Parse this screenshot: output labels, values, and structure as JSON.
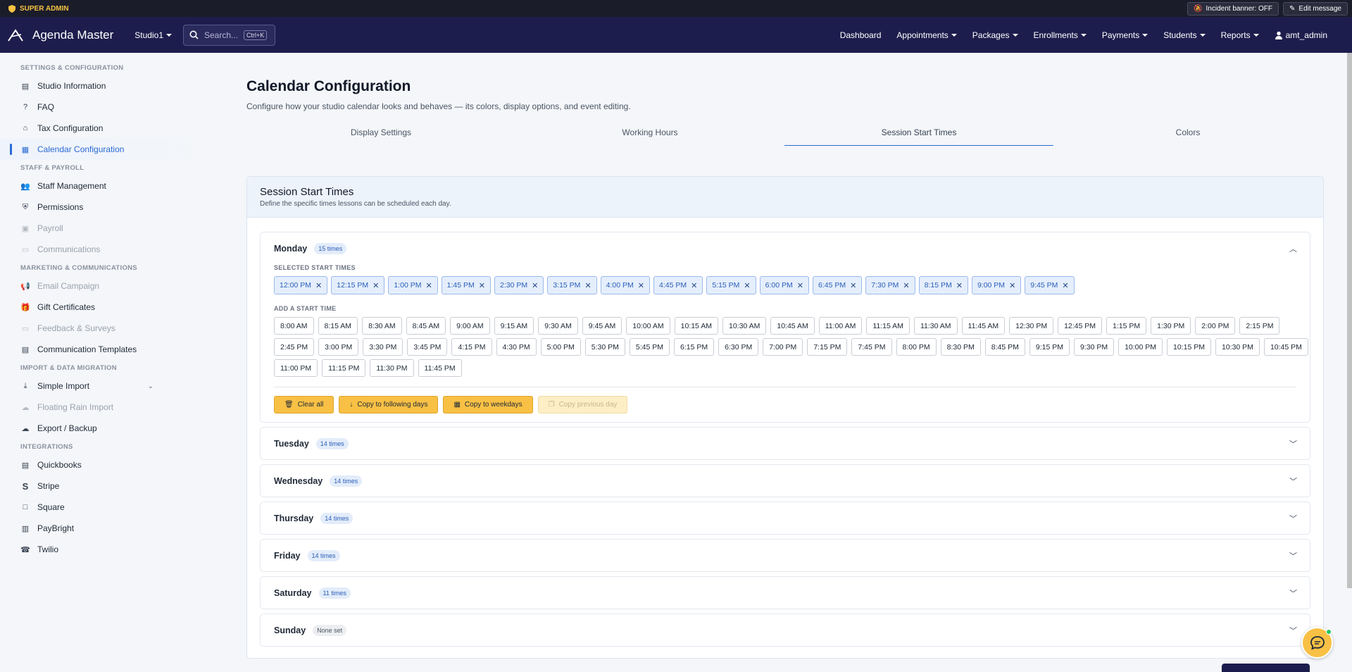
{
  "adminbar": {
    "role": "SUPER ADMIN",
    "incident_label": "Incident banner: OFF",
    "edit_label": "Edit message"
  },
  "nav": {
    "brand": "Agenda Master",
    "studio": "Studio1",
    "search_placeholder": "Search...",
    "search_kbd": "Ctrl+K",
    "links": [
      "Dashboard",
      "Appointments",
      "Packages",
      "Enrollments",
      "Payments",
      "Students",
      "Reports"
    ],
    "user": "amt_admin"
  },
  "sidebar": {
    "sections": [
      {
        "title": "SETTINGS & CONFIGURATION",
        "items": [
          {
            "label": "Studio Information",
            "icon": "id-card-icon"
          },
          {
            "label": "FAQ",
            "icon": "question-icon"
          },
          {
            "label": "Tax Configuration",
            "icon": "bank-icon"
          },
          {
            "label": "Calendar Configuration",
            "icon": "calendar-icon",
            "active": true
          }
        ]
      },
      {
        "title": "STAFF & PAYROLL",
        "items": [
          {
            "label": "Staff Management",
            "icon": "people-icon"
          },
          {
            "label": "Permissions",
            "icon": "shield-icon"
          },
          {
            "label": "Payroll",
            "icon": "payroll-icon",
            "disabled": true
          },
          {
            "label": "Communications",
            "icon": "chat-icon",
            "disabled": true
          }
        ]
      },
      {
        "title": "MARKETING & COMMUNICATIONS",
        "items": [
          {
            "label": "Email Campaign",
            "icon": "megaphone-icon",
            "disabled": true
          },
          {
            "label": "Gift Certificates",
            "icon": "gift-icon"
          },
          {
            "label": "Feedback & Surveys",
            "icon": "feedback-icon",
            "disabled": true
          },
          {
            "label": "Communication Templates",
            "icon": "template-icon"
          }
        ]
      },
      {
        "title": "IMPORT & DATA MIGRATION",
        "items": [
          {
            "label": "Simple Import",
            "icon": "download-icon",
            "chevron": true
          },
          {
            "label": "Floating Rain Import",
            "icon": "cloud-icon",
            "disabled": true
          },
          {
            "label": "Export / Backup",
            "icon": "cloud-upload-icon"
          }
        ]
      },
      {
        "title": "INTEGRATIONS",
        "items": [
          {
            "label": "Quickbooks",
            "icon": "document-icon"
          },
          {
            "label": "Stripe",
            "icon": "stripe-icon"
          },
          {
            "label": "Square",
            "icon": "square-icon"
          },
          {
            "label": "PayBright",
            "icon": "terminal-icon"
          },
          {
            "label": "Twilio",
            "icon": "phone-icon"
          }
        ]
      }
    ]
  },
  "page": {
    "title": "Calendar Configuration",
    "subtitle": "Configure how your studio calendar looks and behaves — its colors, display options, and event editing.",
    "tabs": [
      "Display Settings",
      "Working Hours",
      "Session Start Times",
      "Colors"
    ],
    "active_tab": 2
  },
  "card": {
    "title": "Session Start Times",
    "description": "Define the specific times lessons can be scheduled each day.",
    "selected_label": "SELECTED START TIMES",
    "add_label": "ADD A START TIME",
    "actions": {
      "clear_all": "Clear all",
      "copy_following": "Copy to following days",
      "copy_weekdays": "Copy to weekdays",
      "copy_previous": "Copy previous day"
    },
    "days": [
      {
        "name": "Monday",
        "badge": "15 times",
        "open": true
      },
      {
        "name": "Tuesday",
        "badge": "14 times"
      },
      {
        "name": "Wednesday",
        "badge": "14 times"
      },
      {
        "name": "Thursday",
        "badge": "14 times"
      },
      {
        "name": "Friday",
        "badge": "14 times"
      },
      {
        "name": "Saturday",
        "badge": "11 times"
      },
      {
        "name": "Sunday",
        "badge": "None set",
        "none": true
      }
    ],
    "selected_times": [
      "12:00 PM",
      "12:15 PM",
      "1:00 PM",
      "1:45 PM",
      "2:30 PM",
      "3:15 PM",
      "4:00 PM",
      "4:45 PM",
      "5:15 PM",
      "6:00 PM",
      "6:45 PM",
      "7:30 PM",
      "8:15 PM",
      "9:00 PM",
      "9:45 PM"
    ],
    "available_times": [
      "8:00 AM",
      "8:15 AM",
      "8:30 AM",
      "8:45 AM",
      "9:00 AM",
      "9:15 AM",
      "9:30 AM",
      "9:45 AM",
      "10:00 AM",
      "10:15 AM",
      "10:30 AM",
      "10:45 AM",
      "11:00 AM",
      "11:15 AM",
      "11:30 AM",
      "11:45 AM",
      "12:30 PM",
      "12:45 PM",
      "1:15 PM",
      "1:30 PM",
      "2:00 PM",
      "2:15 PM",
      "2:45 PM",
      "3:00 PM",
      "3:30 PM",
      "3:45 PM",
      "4:15 PM",
      "4:30 PM",
      "5:00 PM",
      "5:30 PM",
      "5:45 PM",
      "6:15 PM",
      "6:30 PM",
      "7:00 PM",
      "7:15 PM",
      "7:45 PM",
      "8:00 PM",
      "8:30 PM",
      "8:45 PM",
      "9:15 PM",
      "9:30 PM",
      "10:00 PM",
      "10:15 PM",
      "10:30 PM",
      "10:45 PM",
      "11:00 PM",
      "11:15 PM",
      "11:30 PM",
      "11:45 PM"
    ]
  },
  "colors": {
    "nav_bg": "#1d1d4d",
    "accent": "#2a6ad3",
    "action_yellow": "#f8c045"
  }
}
